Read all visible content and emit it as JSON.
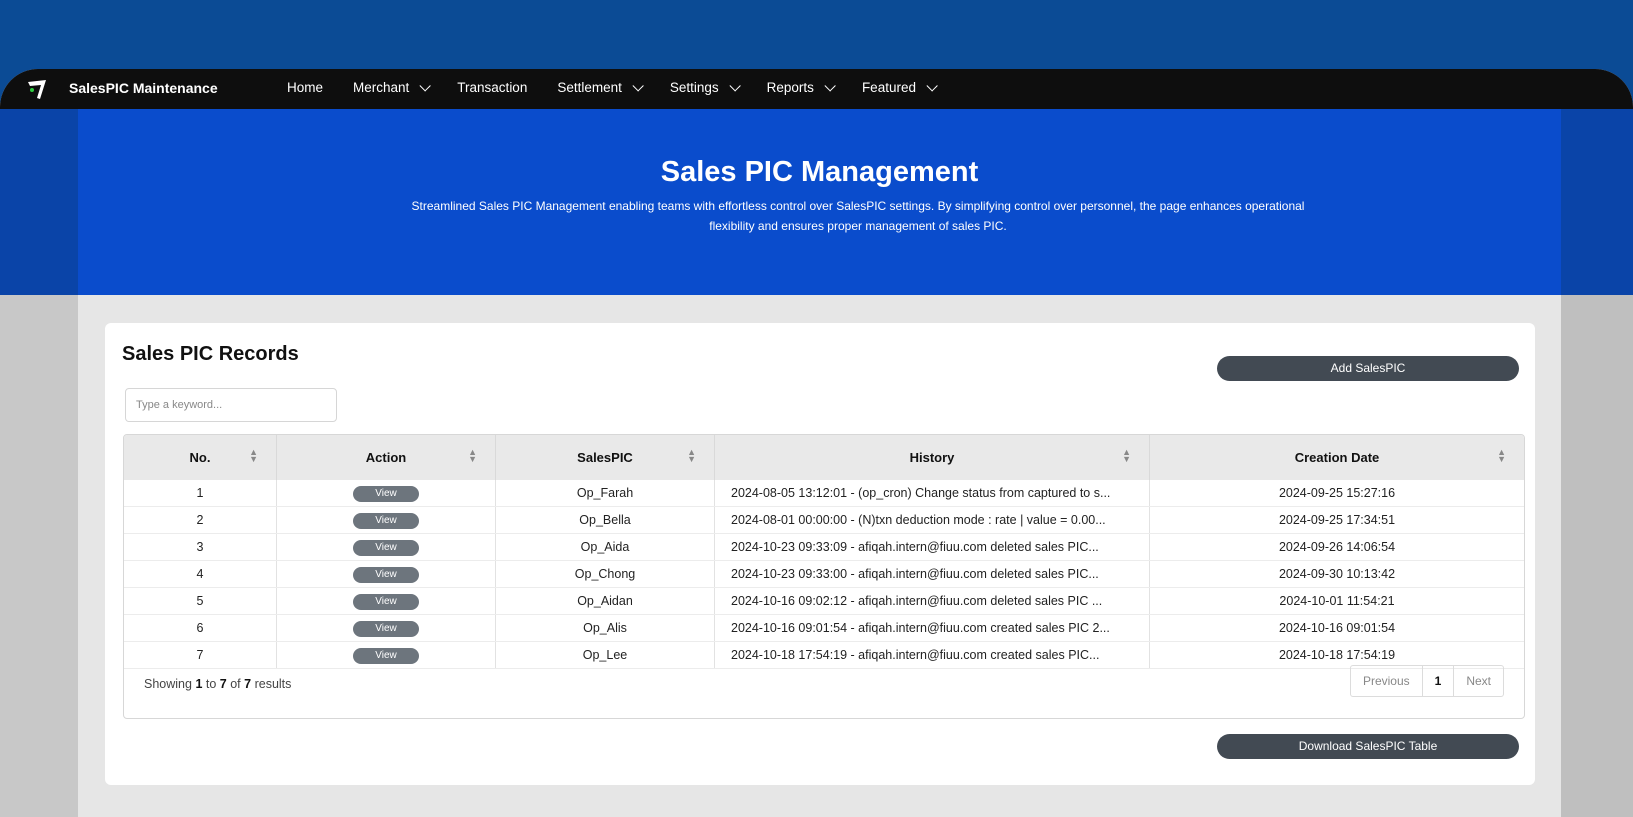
{
  "navbar": {
    "brand": "SalesPIC Maintenance",
    "items": [
      {
        "label": "Home",
        "dropdown": false
      },
      {
        "label": "Merchant",
        "dropdown": true
      },
      {
        "label": "Transaction",
        "dropdown": false
      },
      {
        "label": "Settlement",
        "dropdown": true
      },
      {
        "label": "Settings",
        "dropdown": true
      },
      {
        "label": "Reports",
        "dropdown": true
      },
      {
        "label": "Featured",
        "dropdown": true
      }
    ]
  },
  "banner": {
    "title": "Sales PIC Management",
    "description": "Streamlined Sales PIC Management enabling teams with effortless control over SalesPIC settings. By simplifying control over personnel, the page enhances operational flexibility and ensures proper management of sales PIC."
  },
  "records": {
    "title": "Sales PIC Records",
    "add_button": "Add SalesPIC",
    "download_button": "Download SalesPIC Table",
    "search_placeholder": "Type a keyword...",
    "columns": [
      "No.",
      "Action",
      "SalesPIC",
      "History",
      "Creation Date"
    ],
    "view_label": "View",
    "rows": [
      {
        "no": "1",
        "pic": "Op_Farah",
        "history": "2024-08-05 13:12:01 - (op_cron) Change status from captured to s...",
        "created": "2024-09-25 15:27:16"
      },
      {
        "no": "2",
        "pic": "Op_Bella",
        "history": "2024-08-01 00:00:00 - (N)txn deduction mode : rate | value = 0.00...",
        "created": "2024-09-25 17:34:51"
      },
      {
        "no": "3",
        "pic": "Op_Aida",
        "history": "2024-10-23 09:33:09 - afiqah.intern@fiuu.com deleted sales PIC...",
        "created": "2024-09-26 14:06:54"
      },
      {
        "no": "4",
        "pic": "Op_Chong",
        "history": "2024-10-23 09:33:00 - afiqah.intern@fiuu.com deleted sales PIC...",
        "created": "2024-09-30 10:13:42"
      },
      {
        "no": "5",
        "pic": "Op_Aidan",
        "history": "2024-10-16 09:02:12 - afiqah.intern@fiuu.com deleted sales PIC ...",
        "created": "2024-10-01 11:54:21"
      },
      {
        "no": "6",
        "pic": "Op_Alis",
        "history": "2024-10-16 09:01:54 - afiqah.intern@fiuu.com created sales PIC 2...",
        "created": "2024-10-16 09:01:54"
      },
      {
        "no": "7",
        "pic": "Op_Lee",
        "history": "2024-10-18 17:54:19 - afiqah.intern@fiuu.com created sales PIC...",
        "created": "2024-10-18 17:54:19"
      }
    ],
    "showing": {
      "prefix": "Showing",
      "from": "1",
      "to_word": "to",
      "to": "7",
      "of_word": "of",
      "total": "7",
      "suffix": "results"
    },
    "pager": {
      "previous": "Previous",
      "current": "1",
      "next": "Next"
    }
  }
}
